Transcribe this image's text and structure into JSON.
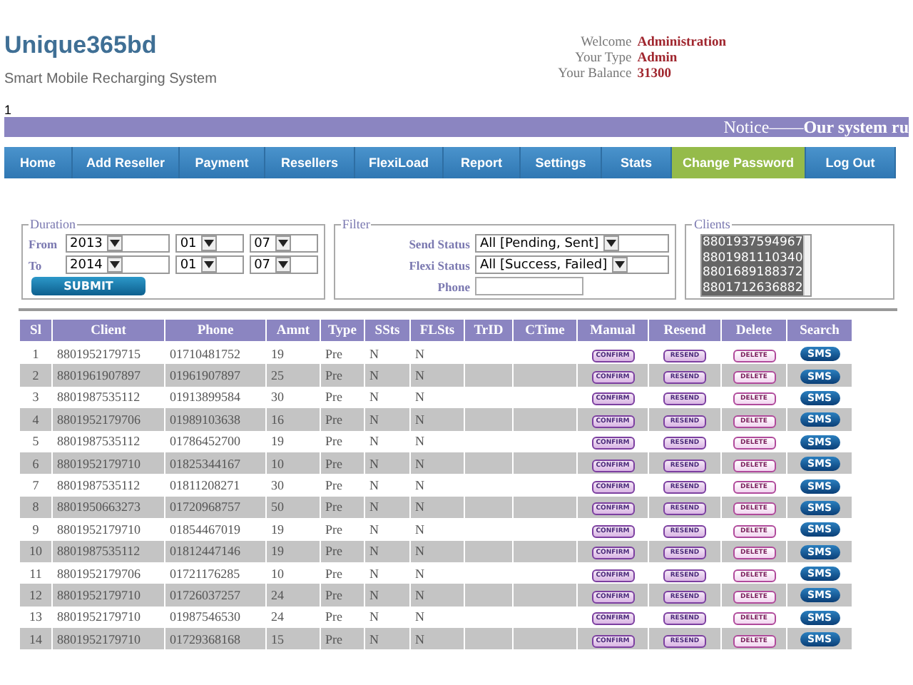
{
  "header": {
    "title": "Unique365bd",
    "subtitle": "Smart Mobile Recharging System",
    "info": [
      {
        "label": "Welcome",
        "value": "Administration"
      },
      {
        "label": "Your Type",
        "value": "Admin"
      },
      {
        "label": "Your Balance",
        "value": "31300"
      }
    ]
  },
  "counter": "1",
  "notice": "Notice——**Our system ru**",
  "nav": [
    {
      "label": "Home",
      "selected": false
    },
    {
      "label": "Add Reseller",
      "selected": false
    },
    {
      "label": "Payment",
      "selected": false
    },
    {
      "label": "Resellers",
      "selected": false
    },
    {
      "label": "FlexiLoad",
      "selected": false
    },
    {
      "label": "Report",
      "selected": false
    },
    {
      "label": "Settings",
      "selected": false
    },
    {
      "label": "Stats",
      "selected": false
    },
    {
      "label": "Change Password",
      "selected": true
    },
    {
      "label": "Log Out",
      "selected": false
    }
  ],
  "duration": {
    "legend": "Duration",
    "rows": [
      {
        "label": "From",
        "year": "2013",
        "month": "01",
        "day": "07"
      },
      {
        "label": "To",
        "year": "2014",
        "month": "01",
        "day": "07"
      }
    ],
    "submit": "SUBMIT"
  },
  "filter": {
    "legend": "Filter",
    "send_status": {
      "label": "Send Status",
      "value": "All [Pending, Sent]"
    },
    "flexi_status": {
      "label": "Flexi Status",
      "value": "All [Success, Failed]"
    },
    "phone": {
      "label": "Phone"
    }
  },
  "clients": {
    "legend": "Clients",
    "items": [
      {
        "label": "8801937594967",
        "selected": true
      },
      {
        "label": "8801981110340",
        "selected": true
      },
      {
        "label": "8801689188372",
        "selected": true
      },
      {
        "label": "8801712636882",
        "selected": true
      }
    ]
  },
  "table": {
    "columns": [
      "Sl",
      "Client",
      "Phone",
      "Amnt",
      "Type",
      "SSts",
      "FLSts",
      "TrID",
      "CTime",
      "Manual",
      "Resend",
      "Delete",
      "Search"
    ],
    "rows": [
      {
        "sl": "1",
        "client": "8801952179715",
        "phone": "01710481752",
        "amount": "19",
        "type": "Pre",
        "ssts": "N",
        "flsts": "N",
        "confirm": "CONFIRM",
        "resend": "RESEND",
        "delete": "DELETE",
        "sms": "SMS"
      },
      {
        "sl": "2",
        "client": "8801961907897",
        "phone": "01961907897",
        "amount": "25",
        "type": "Pre",
        "ssts": "N",
        "flsts": "N",
        "confirm": "CONFIRM",
        "resend": "RESEND",
        "delete": "DELETE",
        "sms": "SMS"
      },
      {
        "sl": "3",
        "client": "8801987535112",
        "phone": "01913899584",
        "amount": "30",
        "type": "Pre",
        "ssts": "N",
        "flsts": "N",
        "confirm": "CONFIRM",
        "resend": "RESEND",
        "delete": "DELETE",
        "sms": "SMS"
      },
      {
        "sl": "4",
        "client": "8801952179706",
        "phone": "01989103638",
        "amount": "16",
        "type": "Pre",
        "ssts": "N",
        "flsts": "N",
        "confirm": "CONFIRM",
        "resend": "RESEND",
        "delete": "DELETE",
        "sms": "SMS"
      },
      {
        "sl": "5",
        "client": "8801987535112",
        "phone": "01786452700",
        "amount": "19",
        "type": "Pre",
        "ssts": "N",
        "flsts": "N",
        "confirm": "CONFIRM",
        "resend": "RESEND",
        "delete": "DELETE",
        "sms": "SMS"
      },
      {
        "sl": "6",
        "client": "8801952179710",
        "phone": "01825344167",
        "amount": "10",
        "type": "Pre",
        "ssts": "N",
        "flsts": "N",
        "confirm": "CONFIRM",
        "resend": "RESEND",
        "delete": "DELETE",
        "sms": "SMS"
      },
      {
        "sl": "7",
        "client": "8801987535112",
        "phone": "01811208271",
        "amount": "30",
        "type": "Pre",
        "ssts": "N",
        "flsts": "N",
        "confirm": "CONFIRM",
        "resend": "RESEND",
        "delete": "DELETE",
        "sms": "SMS"
      },
      {
        "sl": "8",
        "client": "8801950663273",
        "phone": "01720968757",
        "amount": "50",
        "type": "Pre",
        "ssts": "N",
        "flsts": "N",
        "confirm": "CONFIRM",
        "resend": "RESEND",
        "delete": "DELETE",
        "sms": "SMS"
      },
      {
        "sl": "9",
        "client": "8801952179710",
        "phone": "01854467019",
        "amount": "19",
        "type": "Pre",
        "ssts": "N",
        "flsts": "N",
        "confirm": "CONFIRM",
        "resend": "RESEND",
        "delete": "DELETE",
        "sms": "SMS"
      },
      {
        "sl": "10",
        "client": "8801987535112",
        "phone": "01812447146",
        "amount": "19",
        "type": "Pre",
        "ssts": "N",
        "flsts": "N",
        "confirm": "CONFIRM",
        "resend": "RESEND",
        "delete": "DELETE",
        "sms": "SMS"
      },
      {
        "sl": "11",
        "client": "8801952179706",
        "phone": "01721176285",
        "amount": "10",
        "type": "Pre",
        "ssts": "N",
        "flsts": "N",
        "confirm": "CONFIRM",
        "resend": "RESEND",
        "delete": "DELETE",
        "sms": "SMS"
      },
      {
        "sl": "12",
        "client": "8801952179710",
        "phone": "01726037257",
        "amount": "24",
        "type": "Pre",
        "ssts": "N",
        "flsts": "N",
        "confirm": "CONFIRM",
        "resend": "RESEND",
        "delete": "DELETE",
        "sms": "SMS"
      },
      {
        "sl": "13",
        "client": "8801952179710",
        "phone": "01987546530",
        "amount": "24",
        "type": "Pre",
        "ssts": "N",
        "flsts": "N",
        "confirm": "CONFIRM",
        "resend": "RESEND",
        "delete": "DELETE",
        "sms": "SMS"
      },
      {
        "sl": "14",
        "client": "8801952179710",
        "phone": "01729368168",
        "amount": "15",
        "type": "Pre",
        "ssts": "N",
        "flsts": "N",
        "confirm": "CONFIRM",
        "resend": "RESEND",
        "delete": "DELETE",
        "sms": "SMS"
      }
    ]
  }
}
